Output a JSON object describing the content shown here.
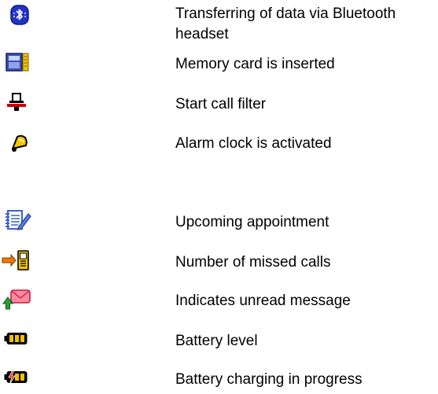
{
  "rows": [
    {
      "icon": "bluetooth-transfer-icon",
      "text": "Transferring of data via Bluetooth headset"
    },
    {
      "icon": "memory-card-icon",
      "text": "Memory card is inserted"
    },
    {
      "icon": "call-filter-icon",
      "text": "Start call filter"
    },
    {
      "icon": "alarm-bell-icon",
      "text": "Alarm clock is activated"
    },
    {
      "icon": "appointment-notepad-icon",
      "text": "Upcoming appointment"
    },
    {
      "icon": "missed-calls-icon",
      "text": "Number of missed calls"
    },
    {
      "icon": "unread-message-icon",
      "text": "Indicates unread message"
    },
    {
      "icon": "battery-level-icon",
      "text": "Battery level"
    },
    {
      "icon": "battery-charging-icon",
      "text": "Battery charging in progress"
    }
  ],
  "colors": {
    "bluetooth_blue": "#2233cc",
    "card_blue": "#3a4fb5",
    "card_yellow": "#f2c200",
    "filter_red": "#cc0000",
    "bell_yellow": "#f5c400",
    "notepad_blue": "#3b62d6",
    "envelope_pink": "#ff8aa0",
    "arrow_green": "#23a23a",
    "battery_yellow": "#f0c000",
    "charge_red": "#e01b1b"
  }
}
